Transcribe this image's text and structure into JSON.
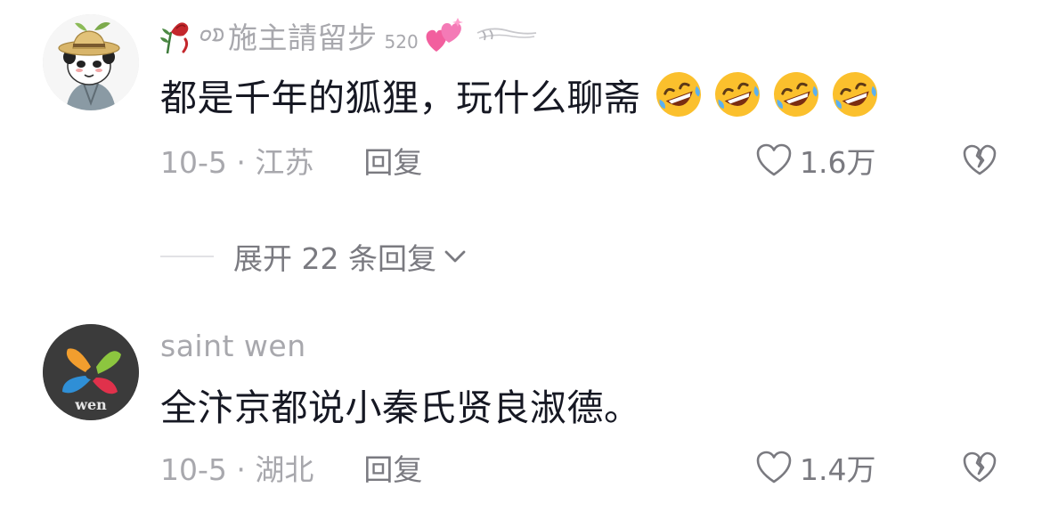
{
  "comments": [
    {
      "avatar_icon": "panda-straw-hat-avatar",
      "username_prefix_icons": [
        "wilted-rose-icon",
        "decorative-symbol-icon"
      ],
      "username": "施主請留步",
      "badge_number": "520",
      "username_suffix_icons": [
        "sparkling-hearts-icon",
        "swoosh-icon"
      ],
      "text": "都是千年的狐狸，玩什么聊斋",
      "emojis": [
        "rofl-emoji",
        "rofl-emoji",
        "rofl-emoji",
        "rofl-emoji"
      ],
      "date_location": "10-5 · 江苏",
      "reply_label": "回复",
      "like_count": "1.6万"
    },
    {
      "avatar_icon": "wen-logo-avatar",
      "username": "saint wen",
      "text": "全汴京都说小秦氏贤良淑德。",
      "date_location": "10-5 · 湖北",
      "reply_label": "回复",
      "like_count": "1.4万"
    }
  ],
  "expand_replies": {
    "label": "展开 22 条回复"
  },
  "colors": {
    "primary_text": "#161823",
    "secondary_text": "#a8a8ad",
    "action_text": "#7a7a80",
    "heart_pink": "#f25f9e",
    "rose_red": "#c4272c",
    "emoji_yellow": "#fbc02d"
  }
}
